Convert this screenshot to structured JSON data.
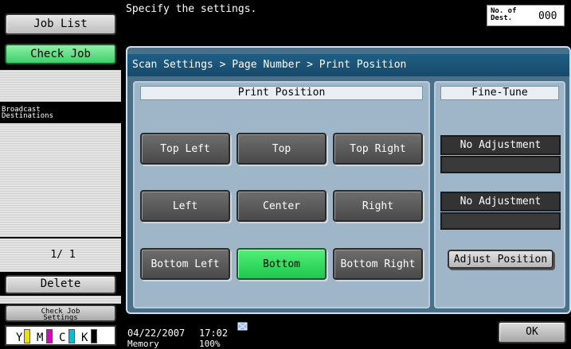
{
  "sidebar": {
    "job_list": "Job List",
    "check_job": "Check Job",
    "broadcast_line1": "Broadcast",
    "broadcast_line2": "Destinations",
    "page_counter": "1/ 1",
    "delete": "Delete",
    "check_job_settings_line1": "Check Job",
    "check_job_settings_line2": "Settings",
    "toner": [
      {
        "label": "Y",
        "color": "#f0e000"
      },
      {
        "label": "M",
        "color": "#e000c0"
      },
      {
        "label": "C",
        "color": "#00c0e0"
      },
      {
        "label": "K",
        "color": "#000000"
      }
    ]
  },
  "header": {
    "message": "Specify the settings.",
    "dest_label_line1": "No. of",
    "dest_label_line2": "Dest.",
    "dest_count": "000"
  },
  "breadcrumb": "Scan Settings > Page Number > Print Position",
  "print_position": {
    "title": "Print Position",
    "buttons": [
      "Top Left",
      "Top",
      "Top Right",
      "Left",
      "Center",
      "Right",
      "Bottom Left",
      "Bottom",
      "Bottom Right"
    ],
    "selected": "Bottom"
  },
  "fine_tune": {
    "title": "Fine-Tune",
    "value1": "No Adjustment",
    "value2": "No Adjustment",
    "adjust_button": "Adjust Position"
  },
  "footer": {
    "date": "04/22/2007",
    "time": "17:02",
    "memory_label": "Memory",
    "memory_value": "100%",
    "ok": "OK"
  },
  "colors": {
    "selected": "#2fd55a",
    "breadcrumb_bg": "#1f5f86",
    "panel_bg": "#9fb6c9"
  }
}
